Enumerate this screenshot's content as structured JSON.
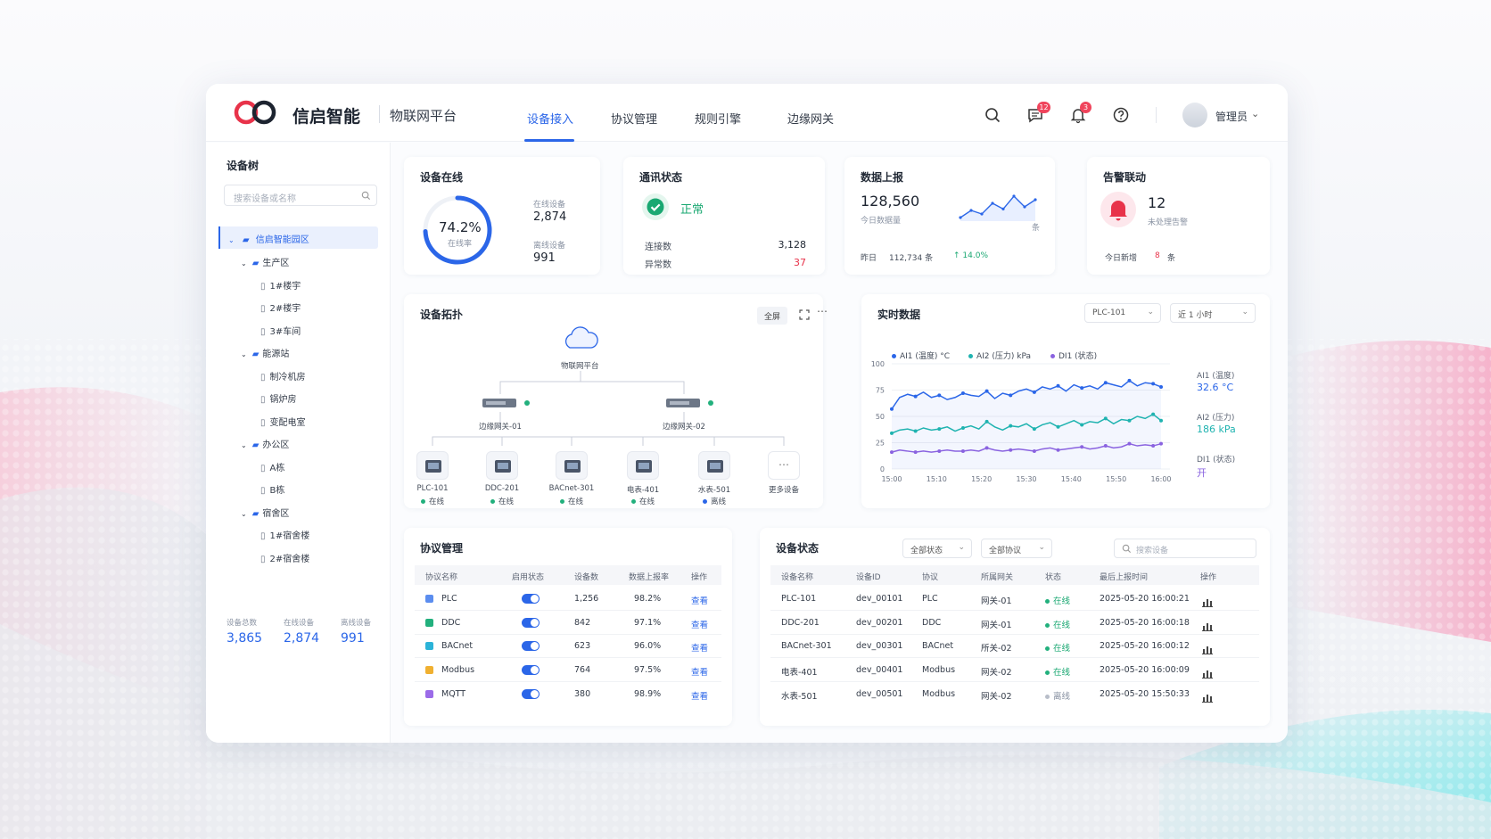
{
  "brand": {
    "name": "信启智能",
    "subtitle": "物联网平台"
  },
  "nav": [
    {
      "label": "设备接入",
      "active": true
    },
    {
      "label": "协议管理"
    },
    {
      "label": "规则引擎"
    },
    {
      "label": "边缘网关"
    }
  ],
  "header": {
    "messages_badge": "12",
    "alerts_badge": "3",
    "user": "管理员"
  },
  "tree": {
    "title": "设备树",
    "search_placeholder": "搜索设备或名称",
    "root": "信启智能园区",
    "nodes": [
      {
        "label": "生产区",
        "level": 1
      },
      {
        "label": "1#楼宇",
        "level": 2
      },
      {
        "label": "2#楼宇",
        "level": 2
      },
      {
        "label": "3#车间",
        "level": 2
      },
      {
        "label": "能源站",
        "level": 1
      },
      {
        "label": "制冷机房",
        "level": 2
      },
      {
        "label": "锅炉房",
        "level": 2
      },
      {
        "label": "变配电室",
        "level": 2
      },
      {
        "label": "办公区",
        "level": 1
      },
      {
        "label": "A栋",
        "level": 2
      },
      {
        "label": "B栋",
        "level": 2
      },
      {
        "label": "宿舍区",
        "level": 1
      },
      {
        "label": "1#宿舍楼",
        "level": 2
      },
      {
        "label": "2#宿舍楼",
        "level": 2
      }
    ],
    "stats": [
      {
        "label": "设备总数",
        "value": "3,865"
      },
      {
        "label": "在线设备",
        "value": "2,874"
      },
      {
        "label": "离线设备",
        "value": "991"
      }
    ]
  },
  "online": {
    "title": "设备在线",
    "rate": "74.2%",
    "rate_value": 74.2,
    "rate_label": "在线率",
    "online_label": "在线设备",
    "online_value": "2,874",
    "offline_label": "离线设备",
    "offline_value": "991"
  },
  "comm": {
    "title": "通讯状态",
    "status": "正常",
    "conn_label": "连接数",
    "conn_value": "3,128",
    "err_label": "异常数",
    "err_value": "37"
  },
  "report": {
    "title": "数据上报",
    "value": "128,560",
    "value_label": "今日数据量",
    "unit": "条",
    "yesterday_label": "昨日",
    "yesterday_value": "112,734 条",
    "change": "↑ 14.0%",
    "spark": [
      3,
      4,
      3.5,
      5,
      4.2,
      6,
      4.5,
      5.5
    ]
  },
  "alarm": {
    "title": "告警联动",
    "value": "12",
    "value_label": "未处理告警",
    "new_label": "今日新增",
    "new_value": "8",
    "new_unit": "条"
  },
  "topology": {
    "title": "设备拓扑",
    "fullscreen": "全屏",
    "cloud_label": "物联网平台",
    "gateways": [
      "边缘网关-01",
      "边缘网关-02"
    ],
    "devices": [
      {
        "name": "PLC-101",
        "status": "在线",
        "color": "#22b07d"
      },
      {
        "name": "DDC-201",
        "status": "在线",
        "color": "#22b07d"
      },
      {
        "name": "BACnet-301",
        "status": "在线",
        "color": "#22b07d"
      },
      {
        "name": "电表-401",
        "status": "在线",
        "color": "#22b07d"
      },
      {
        "name": "水表-501",
        "status": "离线",
        "color": "#2b66e8"
      }
    ],
    "more": "更多设备"
  },
  "realtime": {
    "title": "实时数据",
    "device_select": "PLC-101",
    "range_select": "近 1 小时",
    "legend": [
      {
        "name": "AI1 (温度) °C",
        "color": "#2b66e8"
      },
      {
        "name": "AI2 (压力) kPa",
        "color": "#1fb3b0"
      },
      {
        "name": "DI1 (状态)",
        "color": "#8a63e0"
      }
    ],
    "side": [
      {
        "label": "AI1 (温度)",
        "value": "32.6 °C",
        "color": "#2b66e8"
      },
      {
        "label": "AI2 (压力)",
        "value": "186 kPa",
        "color": "#1fb3b0"
      },
      {
        "label": "DI1 (状态)",
        "value": "开",
        "color": "#8a63e0"
      }
    ]
  },
  "chart_data": {
    "type": "line",
    "x": [
      "15:00",
      "15:10",
      "15:20",
      "15:30",
      "15:40",
      "15:50",
      "16:00"
    ],
    "y_ticks": [
      0,
      25,
      50,
      75,
      100
    ],
    "ylim": [
      0,
      100
    ],
    "series": [
      {
        "name": "AI1 (温度) °C",
        "color": "#2b66e8",
        "values": [
          57,
          68,
          71,
          69,
          73,
          68,
          70,
          66,
          68,
          72,
          70,
          69,
          74,
          67,
          72,
          70,
          74,
          76,
          73,
          78,
          76,
          79,
          74,
          80,
          77,
          79,
          76,
          82,
          80,
          78,
          84,
          79,
          82,
          81,
          78
        ]
      },
      {
        "name": "AI2 (压力) kPa",
        "color": "#1fb3b0",
        "values": [
          34,
          37,
          38,
          36,
          39,
          37,
          38,
          40,
          36,
          39,
          41,
          38,
          45,
          40,
          37,
          41,
          40,
          43,
          38,
          42,
          44,
          40,
          43,
          46,
          42,
          45,
          44,
          48,
          43,
          47,
          46,
          50,
          48,
          52,
          46
        ]
      },
      {
        "name": "DI1 (状态)",
        "color": "#8a63e0",
        "values": [
          16,
          18,
          17,
          16,
          17,
          16,
          17,
          18,
          17,
          17,
          18,
          17,
          20,
          18,
          17,
          18,
          19,
          18,
          17,
          19,
          20,
          18,
          19,
          20,
          21,
          19,
          20,
          22,
          20,
          21,
          24,
          22,
          23,
          22,
          24
        ]
      }
    ]
  },
  "protocols": {
    "title": "协议管理",
    "columns": [
      "协议名称",
      "启用状态",
      "设备数",
      "数据上报率",
      "操作"
    ],
    "rows": [
      {
        "name": "PLC",
        "icon_color": "#5b8def",
        "count": "1,256",
        "rate": "98.2%",
        "action": "查看"
      },
      {
        "name": "DDC",
        "icon_color": "#22b07d",
        "count": "842",
        "rate": "97.1%",
        "action": "查看"
      },
      {
        "name": "BACnet",
        "icon_color": "#2bb3d8",
        "count": "623",
        "rate": "96.0%",
        "action": "查看"
      },
      {
        "name": "Modbus",
        "icon_color": "#f0b030",
        "count": "764",
        "rate": "97.5%",
        "action": "查看"
      },
      {
        "name": "MQTT",
        "icon_color": "#9b6be8",
        "count": "380",
        "rate": "98.9%",
        "action": "查看"
      }
    ]
  },
  "devstatus": {
    "title": "设备状态",
    "filter_status": "全部状态",
    "filter_protocol": "全部协议",
    "search_placeholder": "搜索设备",
    "columns": [
      "设备名称",
      "设备ID",
      "协议",
      "所属网关",
      "状态",
      "最后上报时间",
      "操作"
    ],
    "rows": [
      {
        "name": "PLC-101",
        "id": "dev_00101",
        "proto": "PLC",
        "gw": "网关-01",
        "status": "在线",
        "color": "#22b07d",
        "time": "2025-05-20 16:00:21"
      },
      {
        "name": "DDC-201",
        "id": "dev_00201",
        "proto": "DDC",
        "gw": "网关-01",
        "status": "在线",
        "color": "#22b07d",
        "time": "2025-05-20 16:00:18"
      },
      {
        "name": "BACnet-301",
        "id": "dev_00301",
        "proto": "BACnet",
        "gw": "所关-02",
        "status": "在线",
        "color": "#22b07d",
        "time": "2025-05-20 16:00:12"
      },
      {
        "name": "电表-401",
        "id": "dev_00401",
        "proto": "Modbus",
        "gw": "网关-02",
        "status": "在线",
        "color": "#22b07d",
        "time": "2025-05-20 16:00:09"
      },
      {
        "name": "水表-501",
        "id": "dev_00501",
        "proto": "Modbus",
        "gw": "网关-02",
        "status": "离线",
        "color": "#b8bec9",
        "time": "2025-05-20 15:50:33"
      }
    ]
  }
}
